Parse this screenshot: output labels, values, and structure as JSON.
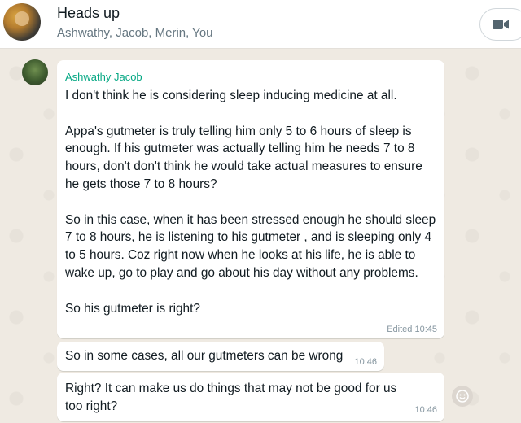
{
  "header": {
    "title": "Heads up",
    "participants": "Ashwathy, Jacob, Merin, You",
    "video_icon": "video-camera-icon"
  },
  "messages": [
    {
      "sender": "Ashwathy Jacob",
      "text": "I don't think he is considering sleep inducing medicine at all.\n\nAppa's gutmeter is truly telling him only 5 to 6 hours of sleep is enough. If his gutmeter was actually telling him he needs 7 to 8 hours, don't don't think he would take actual measures to ensure he gets those 7 to 8 hours?\n\nSo in this case, when it has been stressed enough he should sleep 7 to 8 hours, he is listening to his gutmeter , and is sleeping only 4 to 5 hours. Coz right now when he looks at his life, he is able to wake up, go to play and go about his day without any problems.\n\nSo his gutmeter is right?",
      "meta": "Edited 10:45"
    },
    {
      "text": "So in some cases, all our gutmeters can be wrong",
      "meta": "10:46"
    },
    {
      "text": "Right? It can make us do things that may not be good for us too right?",
      "meta": "10:46"
    }
  ],
  "react_icon": "smiley-icon",
  "colors": {
    "sender_name": "#06a884",
    "chat_bg": "#efeae2",
    "bubble": "#ffffff",
    "meta": "#8696a0"
  }
}
